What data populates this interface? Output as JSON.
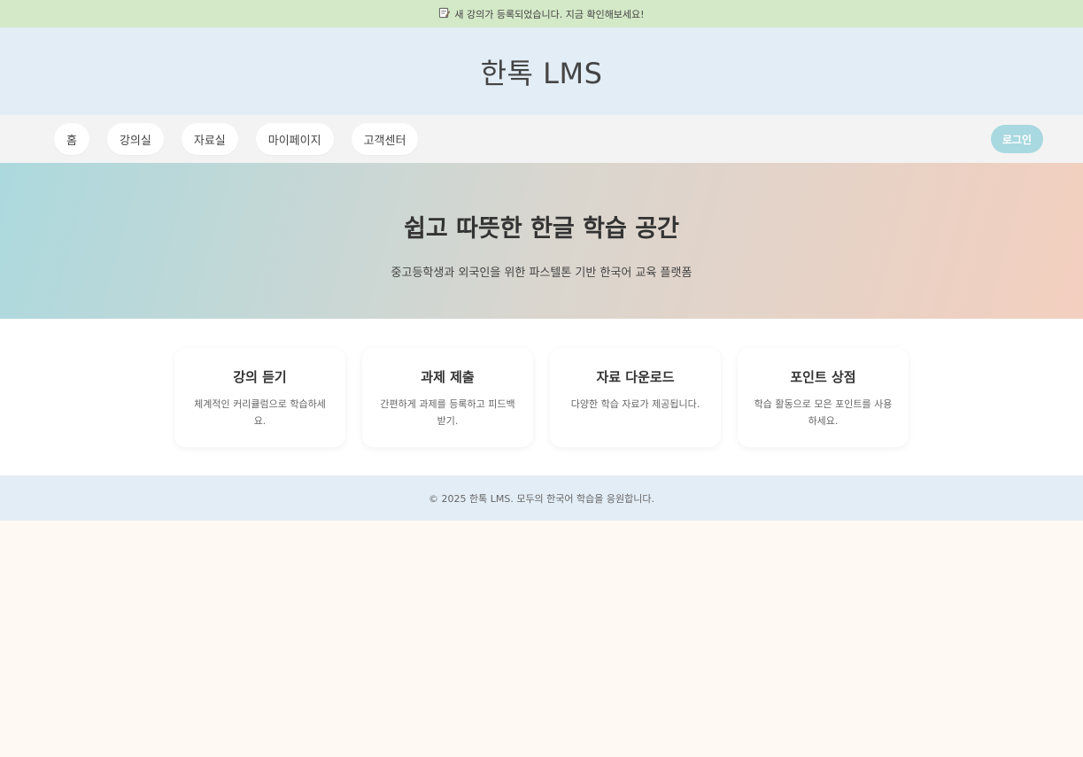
{
  "announcement": {
    "icon": "memo-icon",
    "text": "새 강의가 등록되었습니다. 지금 확인해보세요!"
  },
  "header": {
    "title": "한톡 LMS"
  },
  "nav": {
    "items": [
      {
        "label": "홈"
      },
      {
        "label": "강의실"
      },
      {
        "label": "자료실"
      },
      {
        "label": "마이페이지"
      },
      {
        "label": "고객센터"
      }
    ],
    "login_label": "로그인"
  },
  "hero": {
    "title": "쉽고 따뜻한 한글 학습 공간",
    "subtitle": "중고등학생과 외국인을 위한 파스텔톤 기반 한국어 교육 플랫폼"
  },
  "features": [
    {
      "title": "강의 듣기",
      "description": "체계적인 커리큘럼으로 학습하세요."
    },
    {
      "title": "과제 제출",
      "description": "간편하게 과제를 등록하고 피드백 받기."
    },
    {
      "title": "자료 다운로드",
      "description": "다양한 학습 자료가 제공됩니다."
    },
    {
      "title": "포인트 상점",
      "description": "학습 활동으로 모은 포인트를 사용하세요."
    }
  ],
  "footer": {
    "text": "© 2025 한톡 LMS. 모두의 한국어 학습을 응원합니다."
  },
  "colors": {
    "announcement_bg": "#d4e9c7",
    "header_bg": "#e3edf5",
    "nav_bg": "#f3f3f3",
    "login_button": "#a8d8e0",
    "hero_gradient_start": "#acd9de",
    "hero_gradient_end": "#f3cfbf",
    "page_bg": "#fef9f3"
  }
}
